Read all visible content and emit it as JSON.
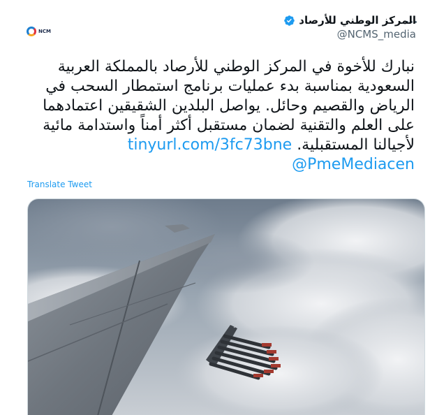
{
  "account": {
    "display_name": "المركز الوطني للأرصاد",
    "handle": "@NCMS_media",
    "verified": true,
    "logo_text": "NCM"
  },
  "tweet": {
    "text_lines": [
      "نبارك للأخوة في المركز الوطني للأرصاد بالمملكة العربية",
      "السعودية بمناسبة بدء عمليات برنامج استمطار السحب في",
      "الرياض والقصيم وحائل. يواصل البلدين الشقيقين اعتمادهما",
      "على العلم والتقنية لضمان مستقبل أكثر أمناً واستدامة مائية"
    ],
    "line5_text": "لأجيالنا المستقبلية.",
    "link": "tinyurl.com/3fc73bne",
    "mention": "@PmeMediacen"
  },
  "actions": {
    "translate_label": "Translate Tweet",
    "more_icon": "more-horizontal-icon"
  },
  "colors": {
    "link": "#1d9bf0",
    "verified_badge": "#1d9bf0",
    "secondary_text": "#536471"
  }
}
